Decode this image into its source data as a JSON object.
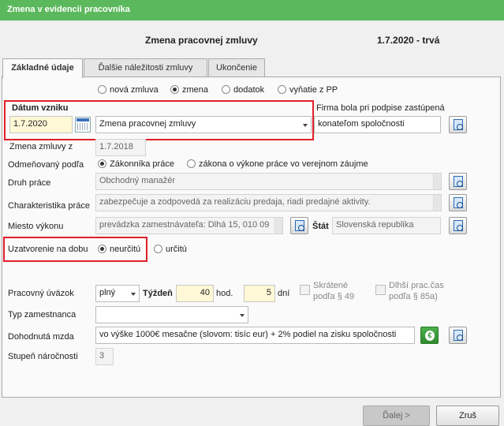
{
  "window": {
    "title": "Zmena v evidencii pracovníka"
  },
  "header": {
    "title": "Zmena pracovnej zmluvy",
    "date_status": "1.7.2020 - trvá"
  },
  "tabs": [
    {
      "label": "Základné údaje"
    },
    {
      "label": "Ďalšie náležitosti zmluvy"
    },
    {
      "label": "Ukončenie"
    }
  ],
  "type_radios": [
    {
      "label": "nová zmluva",
      "selected": false
    },
    {
      "label": "zmena",
      "selected": true
    },
    {
      "label": "dodatok",
      "selected": false
    },
    {
      "label": "vyňatie z PP",
      "selected": false
    }
  ],
  "datum_vzniku": {
    "label": "Dátum vzniku",
    "value": "1.7.2020",
    "type_value": "Zmena pracovnej zmluvy"
  },
  "firma": {
    "label": "Firma bola pri podpise zastúpená",
    "value": "konateľom spoločnosti"
  },
  "zmena_zmluvy": {
    "label": "Zmena zmluvy z",
    "value": "1.7.2018"
  },
  "odmenovany": {
    "label": "Odmeňovaný podľa",
    "options": [
      {
        "label": "Zákonníka práce",
        "selected": true
      },
      {
        "label": "zákona o výkone práce vo verejnom záujme",
        "selected": false
      }
    ]
  },
  "druh_prace": {
    "label": "Druh práce",
    "value": "Obchodný manažér"
  },
  "charakteristika": {
    "label": "Charakteristika práce",
    "value": "zabezpečuje a zodpovedá za realizáciu predaja, riadi predajné aktivity."
  },
  "miesto": {
    "label": "Miesto výkonu",
    "value": "prevádzka zamestnávateľa: Dlhá 15, 010 09",
    "stat_label": "Štát",
    "stat_value": "Slovenská republika"
  },
  "uzatvorenie": {
    "label": "Uzatvorenie na dobu",
    "options": [
      {
        "label": "neurčitú",
        "selected": true
      },
      {
        "label": "určitú",
        "selected": false
      }
    ]
  },
  "uvazok": {
    "label": "Pracovný úväzok",
    "type_value": "plný",
    "tyzden_label": "Týždeň",
    "hours_value": "40",
    "hours_unit": "hod.",
    "days_value": "5",
    "days_unit": "dní",
    "skratene_label_1": "Skrátené",
    "skratene_label_2": "podľa § 49",
    "dlhsi_label_1": "Dlhší prac.čas",
    "dlhsi_label_2": "podľa § 85a)"
  },
  "typ_zamestnanca": {
    "label": "Typ zamestnanca",
    "value": ""
  },
  "mzda": {
    "label": "Dohodnutá mzda",
    "value": "vo výške 1000€ mesačne (slovom: tisíc eur) + 2% podiel na zisku spoločnosti"
  },
  "stupen": {
    "label": "Stupeň náročnosti",
    "value": "3"
  },
  "footer": {
    "next_label": "Ďalej >",
    "cancel_label": "Zruš"
  },
  "colors": {
    "titlebar": "#5cb85c",
    "highlight": "#e0202a",
    "date_field": "#fff8d6"
  }
}
